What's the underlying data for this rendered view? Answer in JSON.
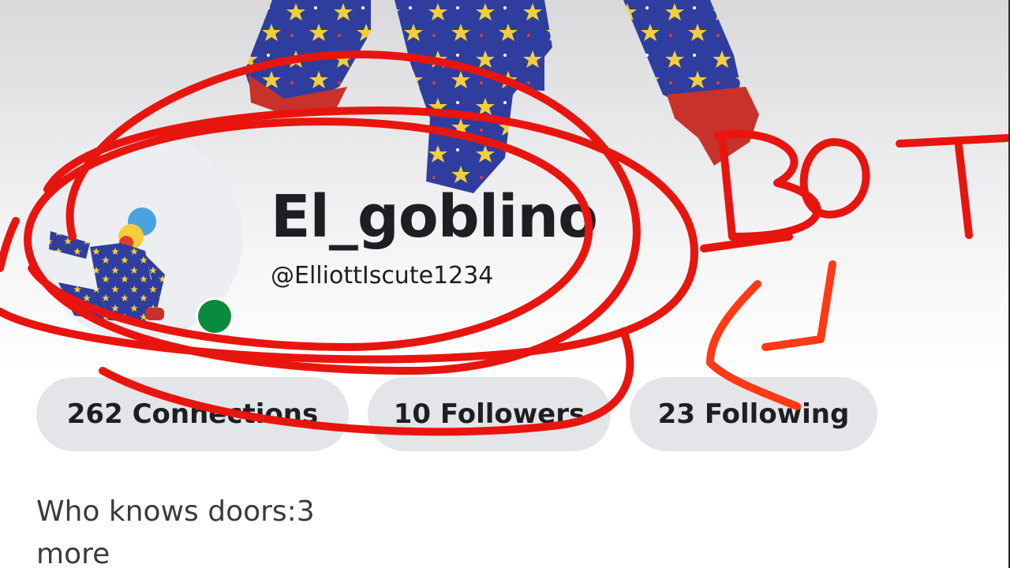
{
  "profile": {
    "display_name": "El_goblino",
    "username": "@ElliottIscute1234",
    "online": true
  },
  "stats": {
    "connections_label": "262 Connections",
    "followers_label": "10 Followers",
    "following_label": "23 Following"
  },
  "bio": {
    "text": "Who knows doors:3",
    "more_label": "more"
  },
  "annotation": {
    "scribble_text": "BOT",
    "scribble_color": "#e8150f"
  },
  "colors": {
    "online_dot": "#0a8a3c",
    "pill_bg": "#e4e5e8",
    "text_primary": "#1d1f22"
  }
}
